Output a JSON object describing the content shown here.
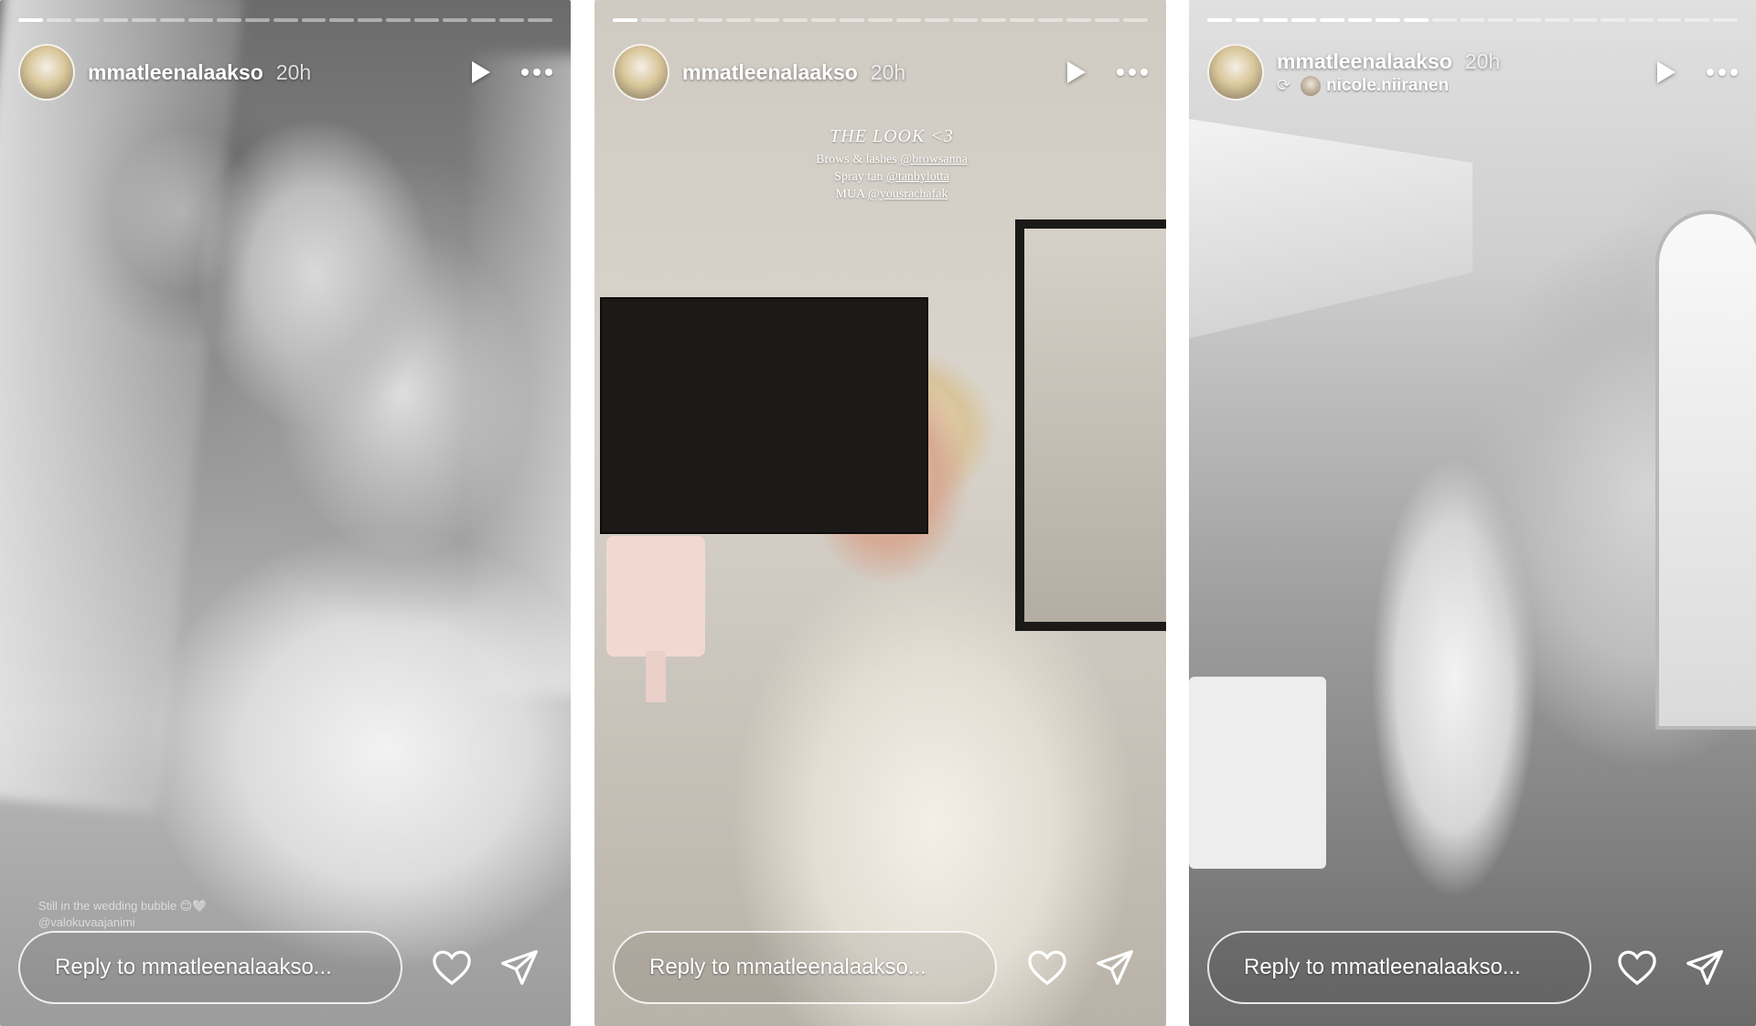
{
  "stories": [
    {
      "id": "story-1",
      "progress": {
        "segments": 19,
        "active": 1
      },
      "header": {
        "username": "mmatleenalaakso",
        "time": "20h"
      },
      "repost": null,
      "caption_overlay": null,
      "faint_caption": [
        "Still in the wedding bubble 😊🤍",
        "@valokuvaajanimi"
      ],
      "reply": {
        "placeholder": "Reply to mmatleenalaakso..."
      }
    },
    {
      "id": "story-2",
      "progress": {
        "segments": 19,
        "active": 1
      },
      "header": {
        "username": "mmatleenalaakso",
        "time": "20h"
      },
      "repost": null,
      "caption_overlay": {
        "title": "THE LOOK <3",
        "lines": [
          {
            "label": "Brows & lashes ",
            "mention": "@browsanna"
          },
          {
            "label": "Spray tan ",
            "mention": "@tanbylotta"
          },
          {
            "label": "MUA ",
            "mention": "@yousrachafak"
          }
        ]
      },
      "faint_caption": null,
      "reply": {
        "placeholder": "Reply to mmatleenalaakso..."
      }
    },
    {
      "id": "story-3",
      "progress": {
        "segments": 19,
        "active": 8
      },
      "header": {
        "username": "mmatleenalaakso",
        "time": "20h"
      },
      "repost": {
        "icon": "repost-icon",
        "username": "nicole.niiranen"
      },
      "caption_overlay": null,
      "faint_caption": null,
      "reply": {
        "placeholder": "Reply to mmatleenalaakso..."
      }
    }
  ],
  "icons": {
    "play": "play-icon",
    "more": "more-icon",
    "like": "heart-icon",
    "share": "send-icon"
  },
  "colors": {
    "overlay_text": "#ffffff"
  }
}
